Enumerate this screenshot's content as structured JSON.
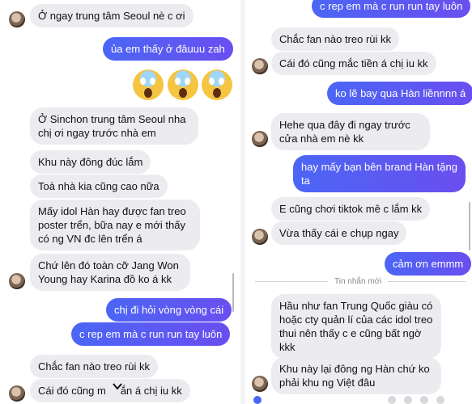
{
  "left": {
    "messages": [
      {
        "text": "Ở ngay trung tâm Seoul nè c ơi"
      },
      {
        "text": "ủa em thấy ở đâuuu zah"
      },
      {
        "text": "Ở Sinchon trung tâm Seoul nha chị ơi ngay trước nhà em"
      },
      {
        "text": "Khu này đông đúc lắm"
      },
      {
        "text": "Toà nhà kia cũng cao nữa"
      },
      {
        "text": "Mấy idol Hàn hay được fan treo poster trển, bữa nay e mới thấy có ng VN đc lên trển á"
      },
      {
        "text": "Chứ lên đó toàn cỡ Jang Won Young hay Karina đồ ko á kk"
      },
      {
        "text": "chị đi hỏi vòng vòng cái"
      },
      {
        "text": "c rep em mà c run run tay luôn"
      },
      {
        "text": "Chắc fan nào treo rùi kk"
      },
      {
        "text": "Cái đó cũng m",
        "text_after": "ắn á chị iu kk"
      }
    ]
  },
  "right": {
    "messages": [
      {
        "text": "c rep em mà c run run tay luôn"
      },
      {
        "text": "Chắc fan nào treo rùi kk"
      },
      {
        "text": "Cái đó cũng mắc tiền á chị iu kk"
      },
      {
        "text": "ko lẽ bay qua Hàn liềnnnn á"
      },
      {
        "text": "Hehe qua đây đi ngay trước cửa nhà em nè kk"
      },
      {
        "text": "hay mấy bạn bên brand Hàn tặng ta"
      },
      {
        "text": "E cũng chơi tiktok mê c lắm kk"
      },
      {
        "text": "Vừa thấy cái e chụp ngay"
      },
      {
        "text": "cảm ơn emmm"
      },
      {
        "text": "Hầu như fan Trung Quốc giàu có hoặc cty quản lí của các idol treo thui nên thấy c e cũng bất ngờ kkk"
      },
      {
        "text": "Khu này lại đông ng Hàn chứ ko phải khu ng Việt đâu"
      }
    ],
    "new_messages_label": "Tin nhắn mới"
  },
  "colors": {
    "incoming": "#ececf0",
    "outgoing_start": "#4b66f5",
    "outgoing_end": "#6a4ef0"
  },
  "icons": [
    "avatar",
    "screaming-face-emoji",
    "chevron-down-icon"
  ]
}
